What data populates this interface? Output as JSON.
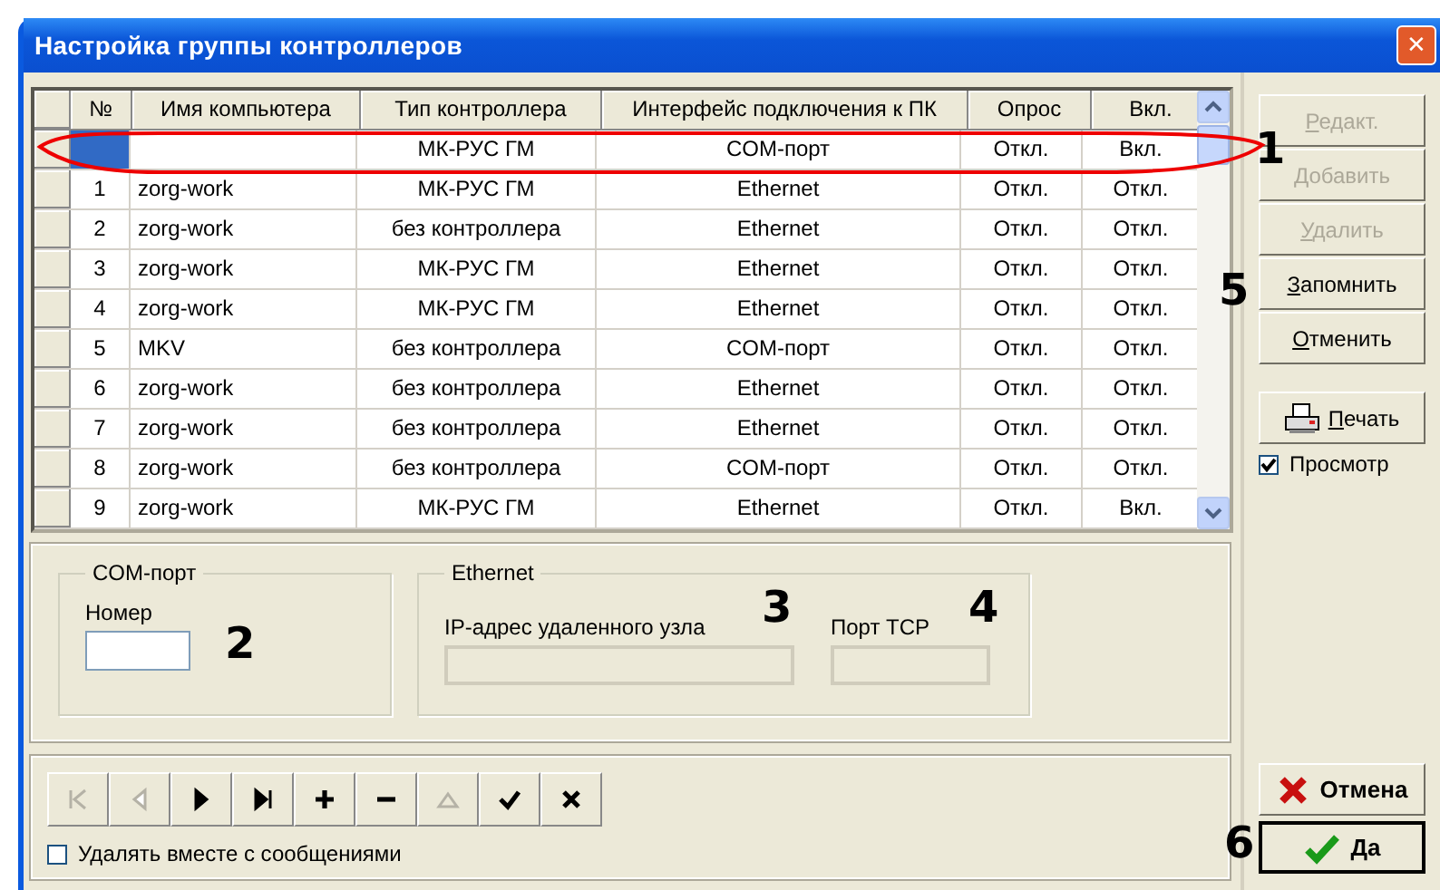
{
  "window": {
    "title": "Настройка группы контроллеров",
    "close": "✕"
  },
  "table": {
    "columns": [
      "№",
      "Имя компьютера",
      "Тип контроллера",
      "Интерфейс подключения к ПК",
      "Опрос",
      "Вкл."
    ],
    "rows": [
      {
        "selected": true,
        "cells": [
          "",
          "",
          "МК-РУС ГМ",
          "COM-порт",
          "Откл.",
          "Вкл."
        ]
      },
      {
        "selected": false,
        "cells": [
          "1",
          "zorg-work",
          "МК-РУС ГМ",
          "Ethernet",
          "Откл.",
          "Откл."
        ]
      },
      {
        "selected": false,
        "cells": [
          "2",
          "zorg-work",
          "без контроллера",
          "Ethernet",
          "Откл.",
          "Откл."
        ]
      },
      {
        "selected": false,
        "cells": [
          "3",
          "zorg-work",
          "МК-РУС ГМ",
          "Ethernet",
          "Откл.",
          "Откл."
        ]
      },
      {
        "selected": false,
        "cells": [
          "4",
          "zorg-work",
          "МК-РУС ГМ",
          "Ethernet",
          "Откл.",
          "Откл."
        ]
      },
      {
        "selected": false,
        "cells": [
          "5",
          "MKV",
          "без контроллера",
          "COM-порт",
          "Откл.",
          "Откл."
        ]
      },
      {
        "selected": false,
        "cells": [
          "6",
          "zorg-work",
          "без контроллера",
          "Ethernet",
          "Откл.",
          "Откл."
        ]
      },
      {
        "selected": false,
        "cells": [
          "7",
          "zorg-work",
          "без контроллера",
          "Ethernet",
          "Откл.",
          "Откл."
        ]
      },
      {
        "selected": false,
        "cells": [
          "8",
          "zorg-work",
          "без контроллера",
          "COM-порт",
          "Откл.",
          "Откл."
        ]
      },
      {
        "selected": false,
        "cells": [
          "9",
          "zorg-work",
          "МК-РУС ГМ",
          "Ethernet",
          "Откл.",
          "Вкл."
        ]
      }
    ]
  },
  "com_group": {
    "title": "COM-порт",
    "number_label": "Номер",
    "number_disabled": false
  },
  "ethernet_group": {
    "title": "Ethernet",
    "ip_label": "IP-адрес удаленного узла",
    "ip_disabled": true,
    "port_label": "Порт TCP",
    "port_disabled": true
  },
  "navigator": [
    {
      "kind": "first",
      "disabled": true
    },
    {
      "kind": "prior",
      "disabled": true
    },
    {
      "kind": "next",
      "disabled": false
    },
    {
      "kind": "last",
      "disabled": false
    },
    {
      "kind": "insert",
      "disabled": false
    },
    {
      "kind": "delete",
      "disabled": false
    },
    {
      "kind": "edit",
      "disabled": true
    },
    {
      "kind": "post",
      "disabled": false
    },
    {
      "kind": "cancel",
      "disabled": false
    }
  ],
  "delete_with_messages": {
    "label": "Удалять вместе с сообщениями",
    "checked": false
  },
  "side_buttons": [
    {
      "label": "Редакт.",
      "disabled": true
    },
    {
      "label": "Добавить",
      "disabled": true
    },
    {
      "label": "Удалить",
      "disabled": true
    },
    {
      "label": "Запомнить",
      "disabled": false
    },
    {
      "label": "Отменить",
      "disabled": false
    }
  ],
  "print_button": {
    "label": "Печать"
  },
  "preview": {
    "label": "Просмотр",
    "checked": true
  },
  "cancel_button": {
    "label": "Отмена"
  },
  "ok_button": {
    "label": "Да"
  },
  "callouts": [
    "1",
    "2",
    "3",
    "4",
    "5",
    "6"
  ]
}
